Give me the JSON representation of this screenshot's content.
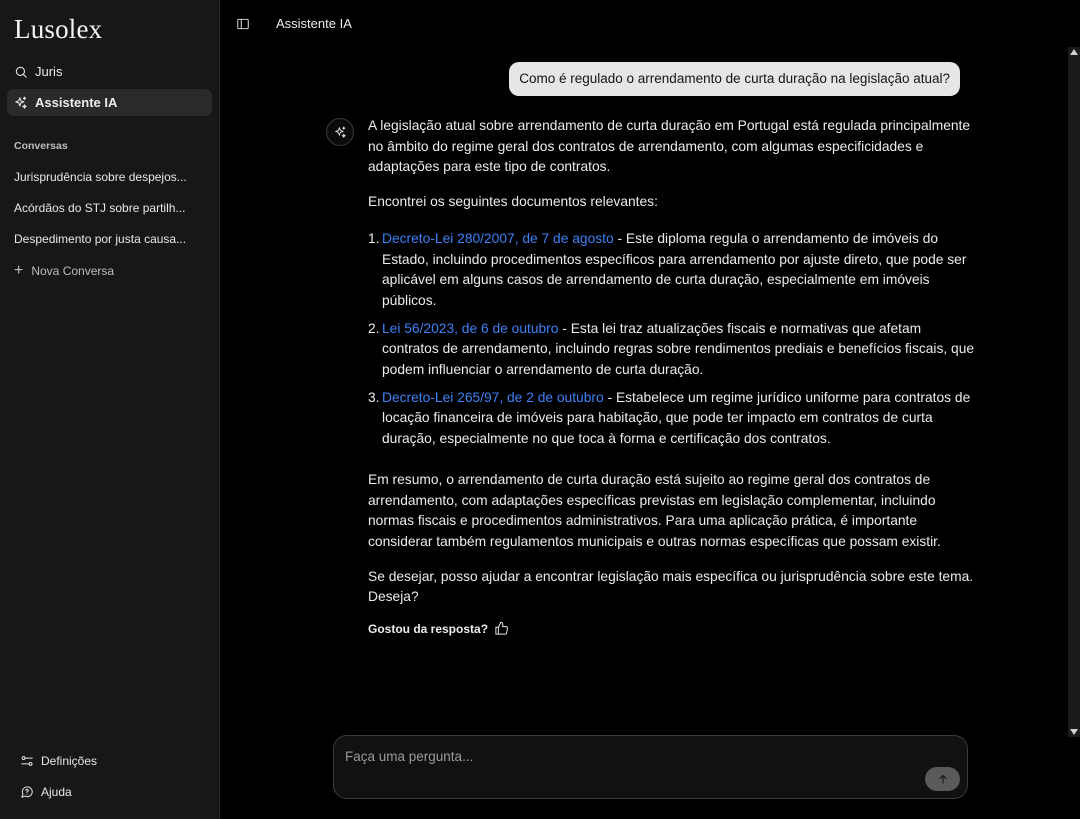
{
  "sidebar": {
    "brand": "Lusolex",
    "nav": [
      {
        "label": "Juris",
        "icon": "search-icon"
      },
      {
        "label": "Assistente IA",
        "icon": "sparkle-icon",
        "active": true
      }
    ],
    "section_title": "Conversas",
    "conversations": [
      "Jurisprudência sobre despejos...",
      "Acórdãos do STJ sobre partilh...",
      "Despedimento por justa causa..."
    ],
    "new_conversation": "Nova Conversa",
    "bottom": [
      {
        "label": "Definições",
        "icon": "settings-icon"
      },
      {
        "label": "Ajuda",
        "icon": "help-icon"
      }
    ]
  },
  "topbar": {
    "title": "Assistente IA"
  },
  "chat": {
    "user_message": "Como é regulado o arrendamento de curta duração na legislação atual?",
    "assistant": {
      "intro": "A legislação atual sobre arrendamento de curta duração em Portugal está regulada principalmente no âmbito do regime geral dos contratos de arrendamento, com algumas especificidades e adaptações para este tipo de contratos.",
      "found": "Encontrei os seguintes documentos relevantes:",
      "documents": [
        {
          "num": "1.",
          "link": "Decreto-Lei 280/2007, de 7 de agosto",
          "text": " - Este diploma regula o arrendamento de imóveis do Estado, incluindo procedimentos específicos para arrendamento por ajuste direto, que pode ser aplicável em alguns casos de arrendamento de curta duração, especialmente em imóveis públicos."
        },
        {
          "num": "2.",
          "link": "Lei 56/2023, de 6 de outubro",
          "text": " - Esta lei traz atualizações fiscais e normativas que afetam contratos de arrendamento, incluindo regras sobre rendimentos prediais e benefícios fiscais, que podem influenciar o arrendamento de curta duração."
        },
        {
          "num": "3.",
          "link": "Decreto-Lei 265/97, de 2 de outubro",
          "text": " - Estabelece um regime jurídico uniforme para contratos de locação financeira de imóveis para habitação, que pode ter impacto em contratos de curta duração, especialmente no que toca à forma e certificação dos contratos."
        }
      ],
      "summary": "Em resumo, o arrendamento de curta duração está sujeito ao regime geral dos contratos de arrendamento, com adaptações específicas previstas em legislação complementar, incluindo normas fiscais e procedimentos administrativos. Para uma aplicação prática, é importante considerar também regulamentos municipais e outras normas específicas que possam existir.",
      "offer": "Se desejar, posso ajudar a encontrar legislação mais específica ou jurisprudência sobre este tema. Deseja?",
      "feedback": "Gostou da resposta?"
    }
  },
  "composer": {
    "placeholder": "Faça uma pergunta..."
  },
  "colors": {
    "link": "#3b82f6",
    "sidebar_bg": "#171717",
    "main_bg": "#000000",
    "user_bubble": "#e6e6e6"
  }
}
